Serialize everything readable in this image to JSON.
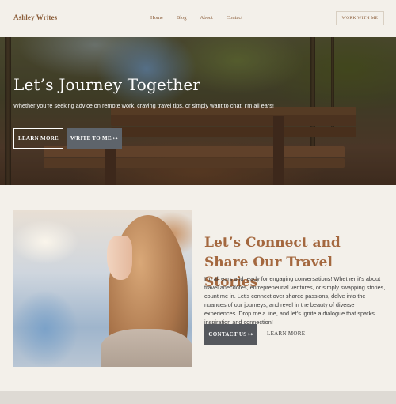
{
  "header": {
    "logo": "Ashley Writes",
    "nav": [
      "Home",
      "Blog",
      "About",
      "Contact"
    ],
    "cta": "WORK WITH ME"
  },
  "hero": {
    "title": "Let’s Journey Together",
    "subtitle": "Whether you’re seeking advice on remote work, craving travel tips, or simply want to chat, I’m all ears!",
    "primary_button": "LEARN MORE",
    "secondary_button": "WRITE TO ME ↦"
  },
  "connect": {
    "title": "Let’s Connect and Share Our Travel Stories",
    "body": "I’m all ears and ready for engaging conversations! Whether it’s about travel anecdotes, entrepreneurial ventures, or simply swapping stories, count me in. Let’s connect over shared passions, delve into the nuances of our journeys, and revel in the beauty of diverse experiences. Drop me a line, and let’s ignite a dialogue that sparks inspiration and connection!",
    "contact_button": "CONTACT US ↦",
    "learn_button": "LEARN MORE"
  },
  "colors": {
    "background": "#f3f0ea",
    "accent": "#a4683f",
    "button_dark": "#55585d"
  }
}
